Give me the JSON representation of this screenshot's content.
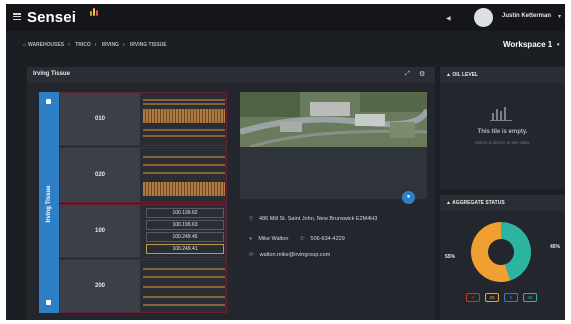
{
  "app": {
    "logo": "Sensei",
    "user_name": "Justin Ketterman",
    "colors": {
      "accent": "#2f7fc7",
      "brand_spark": "#e0a21a",
      "alert": "#6b1f33",
      "donut_green": "#2bb5a0",
      "donut_orange": "#f0a030"
    }
  },
  "breadcrumb": [
    "WAREHOUSES",
    "TRICO",
    "IRVING",
    "IRVING TISSUE"
  ],
  "workspace": {
    "label": "Workspace 1"
  },
  "main_panel": {
    "title": "Irving Tissue",
    "tier_label": "Irving Tissue",
    "rows": [
      {
        "label": "010"
      },
      {
        "label": "020"
      },
      {
        "label": "100",
        "ips": [
          "100.199.62",
          "100.199.63",
          "100.249.45",
          "100.249.41"
        ]
      },
      {
        "label": "200"
      }
    ]
  },
  "location": {
    "address": "486 Mill St. Saint John, New Brunswick E2M4H3",
    "contact_name": "Mike Walton",
    "phone": "506-634-4229",
    "email": "walton.mike@irvingroup.com"
  },
  "oil_level": {
    "title": "OIL LEVEL",
    "empty_title": "This tile is empty.",
    "empty_sub": "Select a device to see data."
  },
  "aggregate_status": {
    "title": "AGGREGATE STATUS",
    "slices": [
      {
        "label": "55%",
        "value": 55,
        "color": "#f0a030"
      },
      {
        "label": "45%",
        "value": 45,
        "color": "#2bb5a0"
      }
    ],
    "legend": [
      {
        "value": "0",
        "color": "#c0392b"
      },
      {
        "value": "28",
        "color": "#f0a030"
      },
      {
        "value": "0",
        "color": "#2f7fc7"
      },
      {
        "value": "33",
        "color": "#2bb5a0"
      }
    ]
  }
}
